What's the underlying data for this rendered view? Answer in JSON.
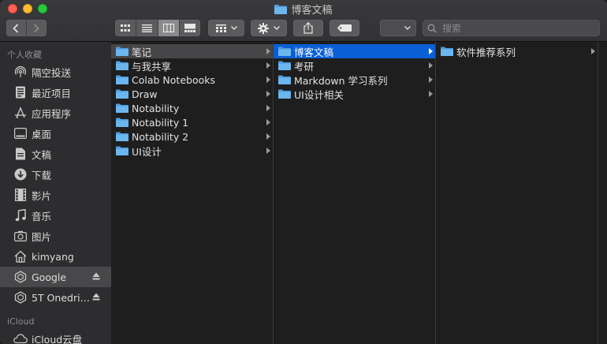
{
  "window": {
    "title": "博客文稿"
  },
  "toolbar": {
    "view_modes": [
      "icon-view",
      "list-view",
      "column-view",
      "gallery-view"
    ],
    "active_view": "column-view"
  },
  "search": {
    "placeholder": "搜索"
  },
  "sidebar": {
    "favorites_header": "个人收藏",
    "items": [
      {
        "label": "隔空投送",
        "icon": "airdrop-icon"
      },
      {
        "label": "最近项目",
        "icon": "recents-icon"
      },
      {
        "label": "应用程序",
        "icon": "applications-icon"
      },
      {
        "label": "桌面",
        "icon": "desktop-icon"
      },
      {
        "label": "文稿",
        "icon": "documents-icon"
      },
      {
        "label": "下载",
        "icon": "downloads-icon"
      },
      {
        "label": "影片",
        "icon": "movies-icon"
      },
      {
        "label": "音乐",
        "icon": "music-icon"
      },
      {
        "label": "图片",
        "icon": "pictures-icon"
      },
      {
        "label": "kimyang",
        "icon": "home-icon"
      },
      {
        "label": "Google",
        "icon": "drive-icon",
        "selected": true,
        "eject": true
      },
      {
        "label": "5T Onedri…",
        "icon": "drive-icon",
        "eject": true
      }
    ],
    "icloud_header": "iCloud",
    "icloud_items": [
      {
        "label": "iCloud云盘",
        "icon": "icloud-icon"
      }
    ]
  },
  "columns": [
    {
      "items": [
        {
          "label": "笔记",
          "state": "selected-inactive"
        },
        {
          "label": "与我共享"
        },
        {
          "label": "Colab Notebooks"
        },
        {
          "label": "Draw"
        },
        {
          "label": "Notability"
        },
        {
          "label": "Notability 1"
        },
        {
          "label": "Notability 2"
        },
        {
          "label": "UI设计"
        }
      ]
    },
    {
      "items": [
        {
          "label": "博客文稿",
          "state": "selected-active"
        },
        {
          "label": "考研"
        },
        {
          "label": "Markdown 学习系列"
        },
        {
          "label": "UI设计相关"
        }
      ]
    },
    {
      "items": [
        {
          "label": "软件推荐系列"
        }
      ]
    }
  ],
  "colors": {
    "selection_active": "#0a5fd6",
    "selection_inactive": "#464648",
    "folder": "#5aa9e6"
  }
}
